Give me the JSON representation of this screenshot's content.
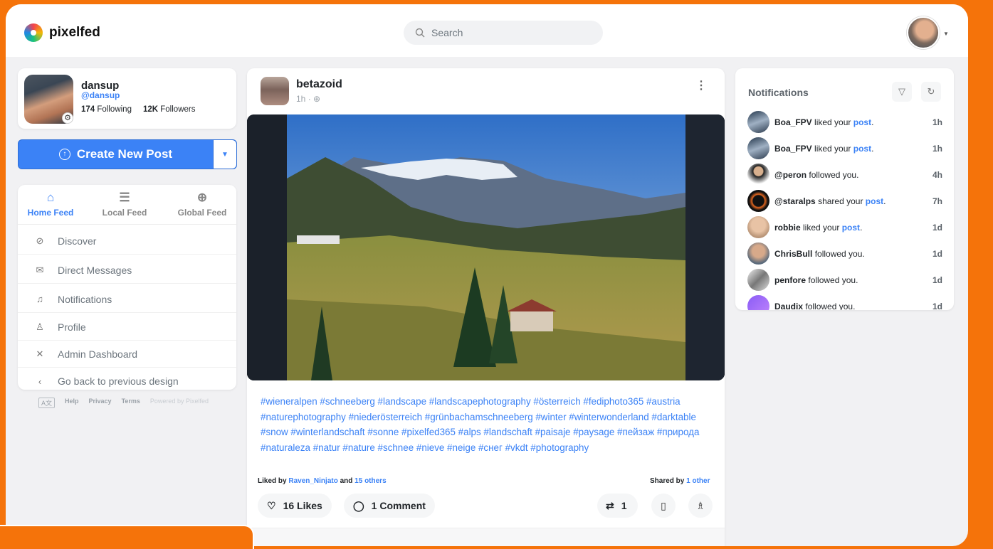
{
  "app": {
    "name": "pixelfed"
  },
  "search": {
    "placeholder": "Search"
  },
  "profile": {
    "name": "dansup",
    "handle": "@dansup",
    "following_count": "174",
    "following_label": "Following",
    "followers_count": "12K",
    "followers_label": "Followers"
  },
  "create": {
    "label": "Create New Post"
  },
  "feeds": [
    {
      "label": "Home Feed",
      "icon": "home-icon"
    },
    {
      "label": "Local Feed",
      "icon": "list-icon"
    },
    {
      "label": "Global Feed",
      "icon": "globe-icon"
    }
  ],
  "nav": [
    {
      "label": "Discover",
      "icon": "compass-icon"
    },
    {
      "label": "Direct Messages",
      "icon": "envelope-icon"
    },
    {
      "label": "Notifications",
      "icon": "bell-icon"
    },
    {
      "label": "Profile",
      "icon": "user-icon"
    },
    {
      "label": "Admin Dashboard",
      "icon": "tools-icon"
    },
    {
      "label": "Go back to previous design",
      "icon": "chevron-left-icon"
    }
  ],
  "footer": {
    "lang": "A文",
    "help": "Help",
    "privacy": "Privacy",
    "terms": "Terms",
    "powered": "Powered by Pixelfed"
  },
  "post": {
    "username": "betazoid",
    "time": "1h",
    "separator": "·",
    "caption": "#wieneralpen #schneeberg #landscape #landscapephotography #österreich #fediphoto365 #austria #naturephotography #niederösterreich #grünbachamschneeberg #winter #winterwonderland #darktable #snow #winterlandschaft #sonne #pixelfed365 #alps #landschaft #paisaje #paysage #пейзаж #природа #naturaleza #natur #nature #schnee #nieve #neige #снег #vkdt #photography",
    "liked_prefix": "Liked by",
    "liked_user": "Raven_Ninjato",
    "liked_and": "and",
    "liked_others": "15 others",
    "shared_prefix": "Shared by",
    "shared_others": "1 other",
    "likes_label": "16 Likes",
    "comments_label": "1 Comment",
    "shares_count": "1"
  },
  "notifications": {
    "title": "Notifications",
    "items": [
      {
        "user": "Boa_FPV",
        "action": "liked your",
        "link": "post",
        "end": ".",
        "time": "1h"
      },
      {
        "user": "Boa_FPV",
        "action": "liked your",
        "link": "post",
        "end": ".",
        "time": "1h"
      },
      {
        "user": "@peron",
        "action": "followed you.",
        "link": "",
        "end": "",
        "time": "4h"
      },
      {
        "user": "@staralps",
        "action": "shared your",
        "link": "post",
        "end": ".",
        "time": "7h"
      },
      {
        "user": "robbie",
        "action": "liked your",
        "link": "post",
        "end": ".",
        "time": "1d"
      },
      {
        "user": "ChrisBull",
        "action": "followed you.",
        "link": "",
        "end": "",
        "time": "1d"
      },
      {
        "user": "penfore",
        "action": "followed you.",
        "link": "",
        "end": "",
        "time": "1d"
      },
      {
        "user": "Daudix",
        "action": "followed you.",
        "link": "",
        "end": "",
        "time": "1d"
      }
    ]
  },
  "colors": {
    "accent": "#3b82f6",
    "background": "#f5730a"
  }
}
